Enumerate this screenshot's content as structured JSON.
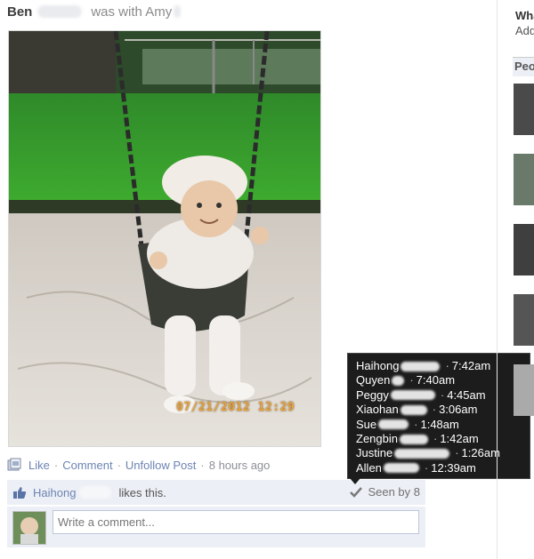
{
  "post": {
    "author": "Ben",
    "with_text": "was with Amy",
    "photo_date_stamp": "07/21/2012  12:29"
  },
  "actions": {
    "like": "Like",
    "comment": "Comment",
    "unfollow": "Unfollow Post",
    "separator": "·",
    "timestamp": "8 hours ago"
  },
  "likes": {
    "name": "Haihong",
    "text": "likes this.",
    "seen_by": "Seen by 8"
  },
  "comment": {
    "placeholder": "Write a comment..."
  },
  "seen_list": [
    {
      "name": "Haihong",
      "time": "7:42am"
    },
    {
      "name": "Quyen",
      "time": "7:40am"
    },
    {
      "name": "Peggy",
      "time": "4:45am"
    },
    {
      "name": "Xiaohan",
      "time": "3:06am"
    },
    {
      "name": "Sue",
      "time": "1:48am"
    },
    {
      "name": "Zengbin",
      "time": "1:42am"
    },
    {
      "name": "Justine",
      "time": "1:26am"
    },
    {
      "name": "Allen",
      "time": "12:39am"
    }
  ],
  "sidebar": {
    "title": "Wha",
    "subtitle": "Add",
    "people_heading": "Peo"
  },
  "colors": {
    "link": "#6d84b4",
    "action_bg": "#eceff5",
    "tooltip_bg": "#1c1c1c"
  }
}
